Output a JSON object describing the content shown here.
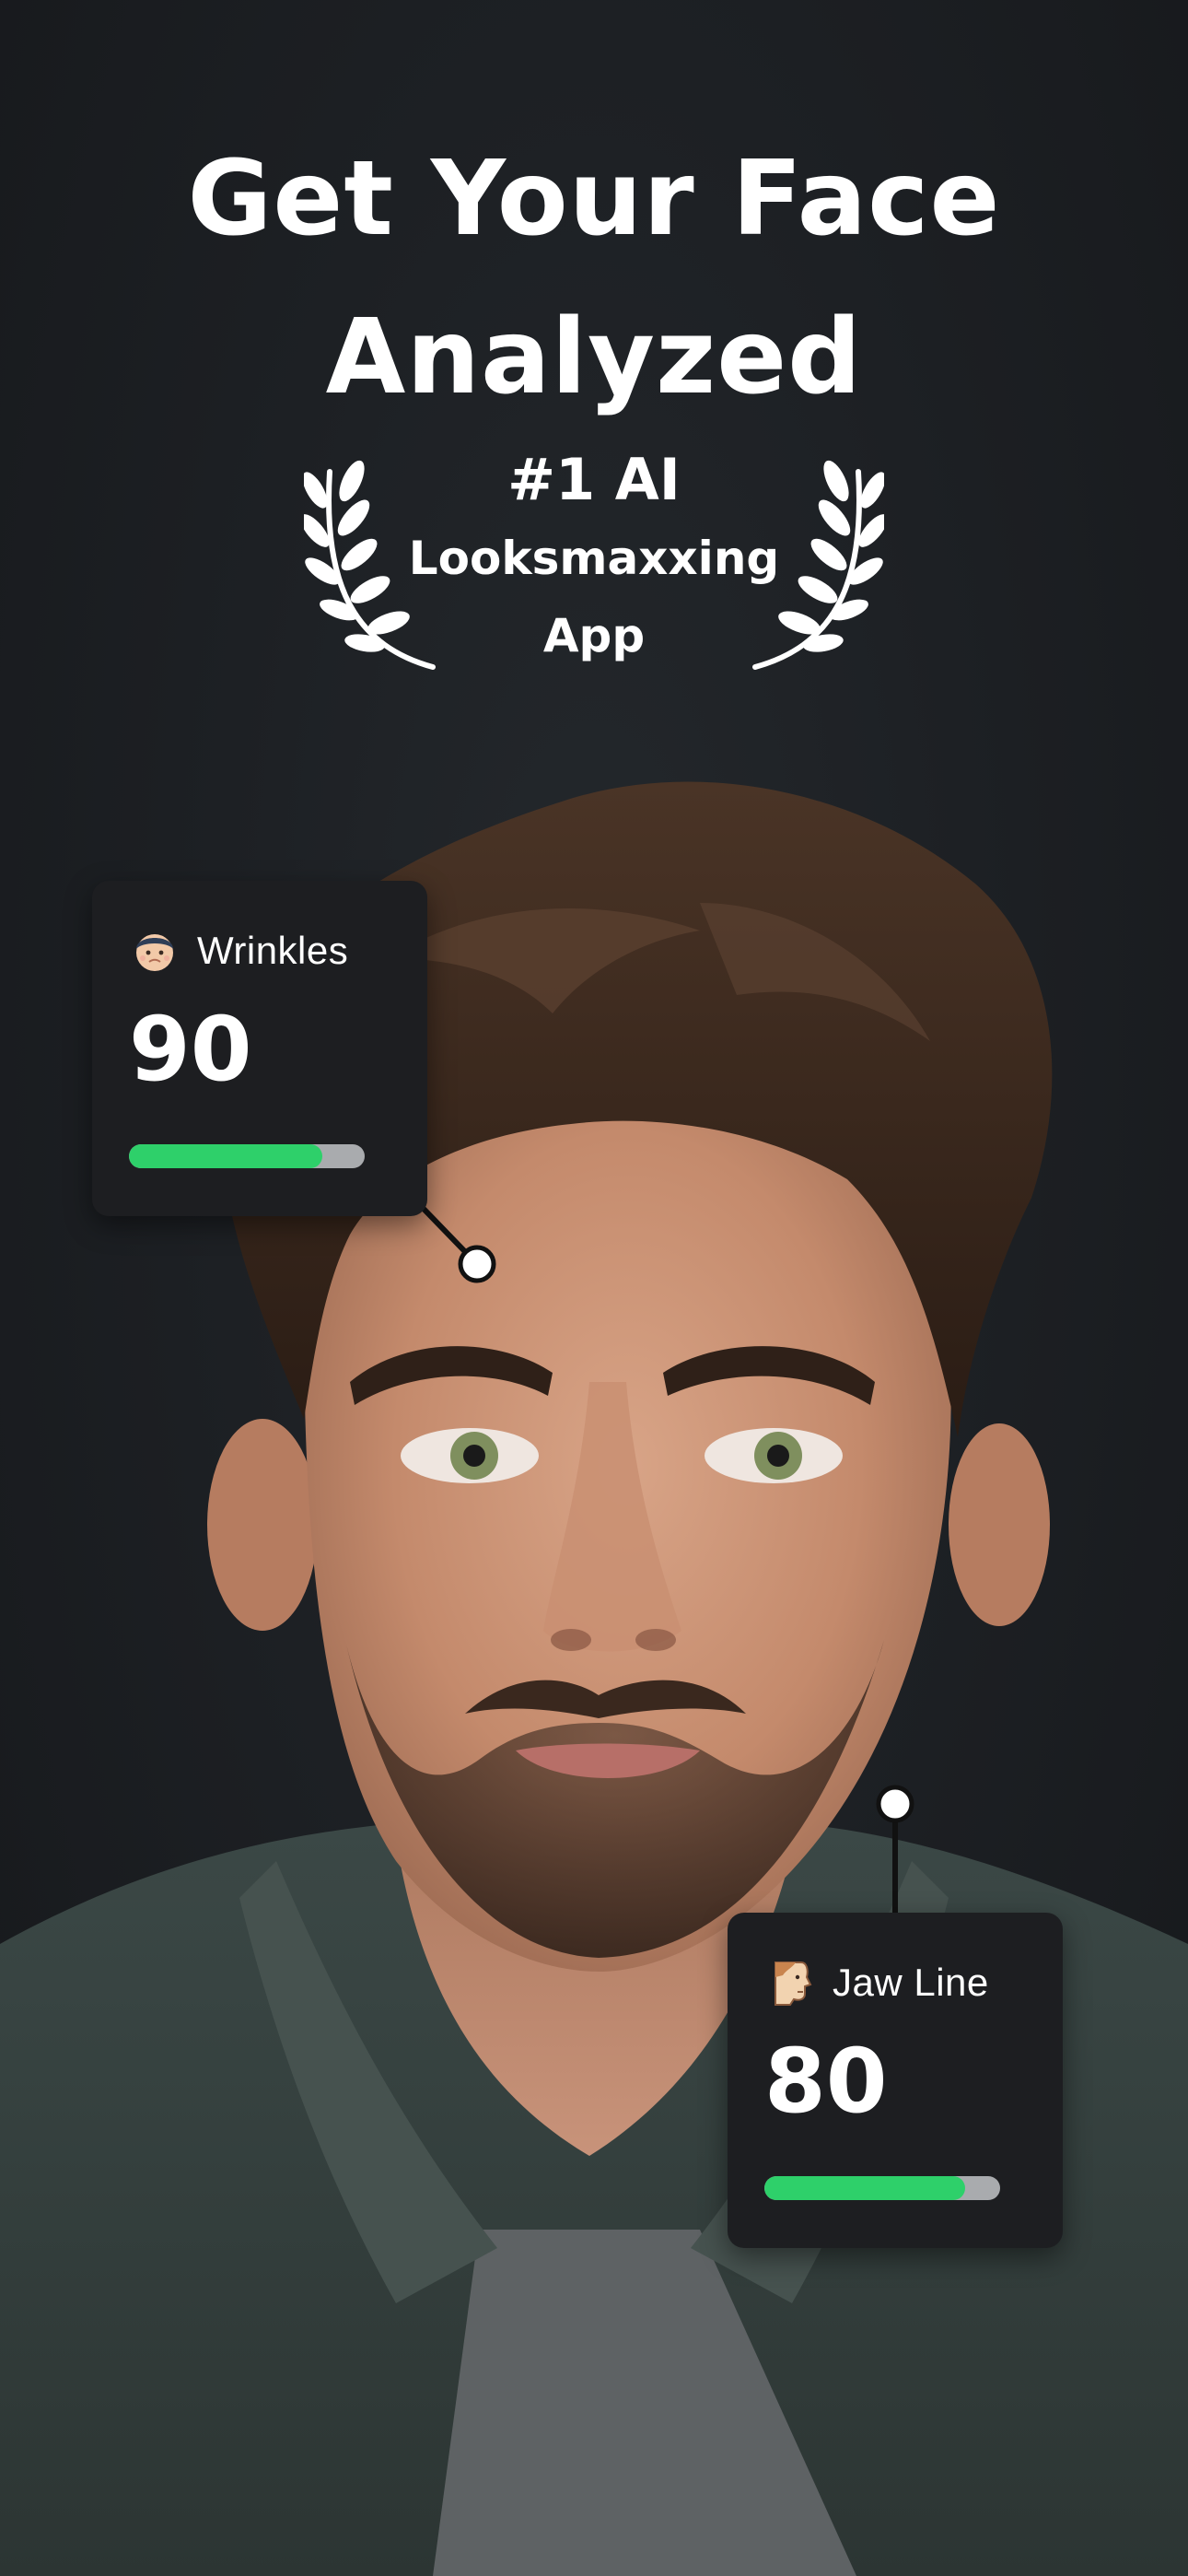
{
  "header": {
    "headline_line1": "Get Your Face",
    "headline_line2": "Analyzed"
  },
  "award": {
    "rank": "#1 AI",
    "line1": "Looksmaxxing",
    "line2": "App"
  },
  "metrics": [
    {
      "label": "Wrinkles",
      "score": "90",
      "progress": 0.82,
      "icon": "face-avatar-icon"
    },
    {
      "label": "Jaw Line",
      "score": "80",
      "progress": 0.85,
      "icon": "jaw-profile-icon"
    }
  ],
  "colors": {
    "background": "#1c1f22",
    "card": "#1d1e21",
    "progress_fill": "#2ed06a",
    "progress_track": "#a9abae",
    "text": "#ffffff"
  }
}
